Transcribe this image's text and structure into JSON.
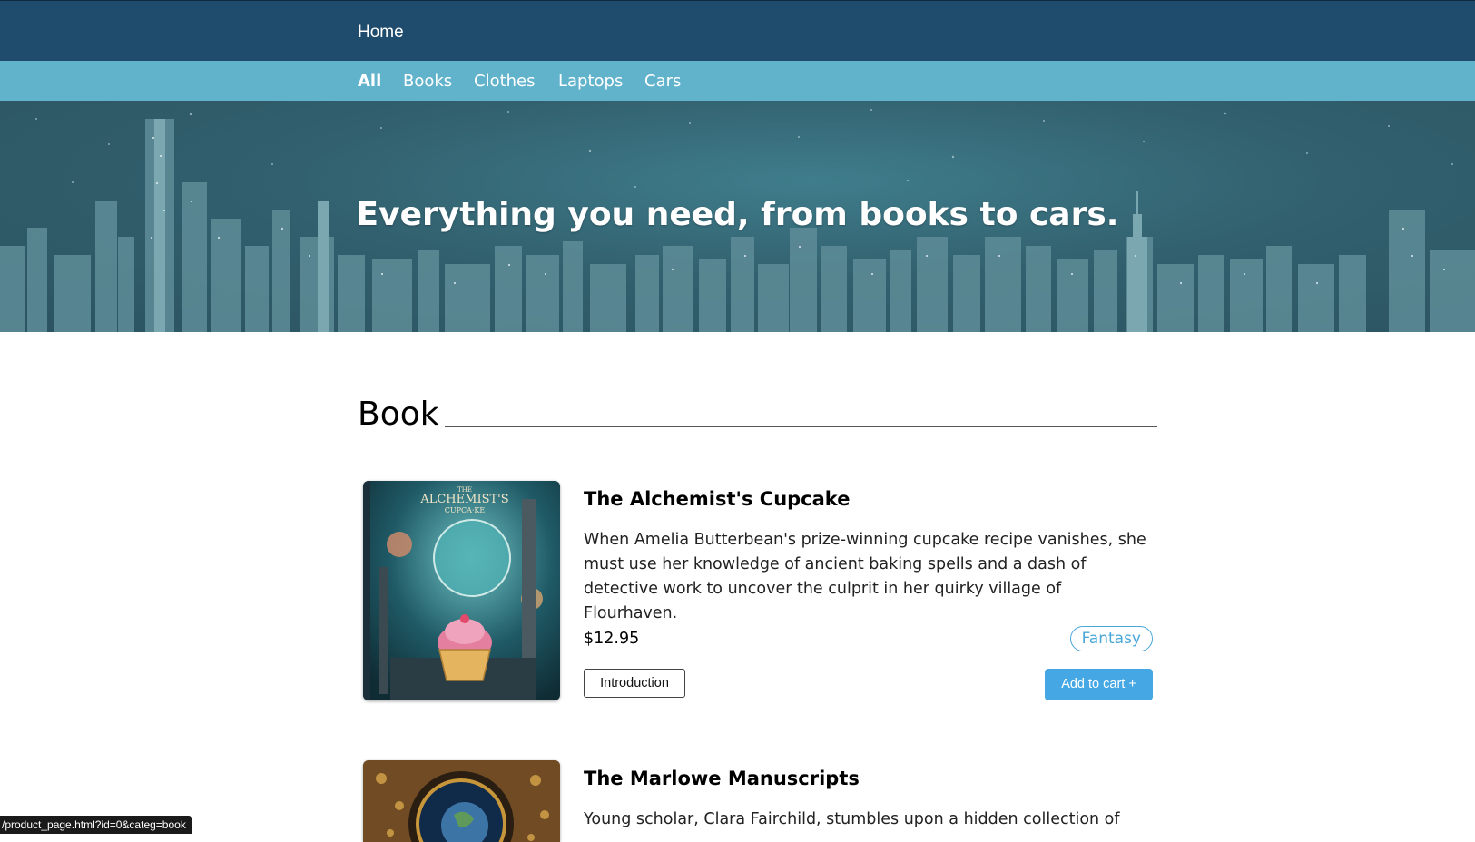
{
  "header": {
    "home_label": "Home"
  },
  "categories": [
    {
      "label": "All",
      "active": true
    },
    {
      "label": "Books",
      "active": false
    },
    {
      "label": "Clothes",
      "active": false
    },
    {
      "label": "Laptops",
      "active": false
    },
    {
      "label": "Cars",
      "active": false
    }
  ],
  "hero": {
    "title": "Everything you need, from books to cars."
  },
  "section": {
    "title": "Book"
  },
  "products": [
    {
      "title": "The Alchemist's Cupcake",
      "cover_title_line1": "THE",
      "cover_title_line2": "ALCHEMIST'S",
      "cover_title_line3": "CUPCA·KE",
      "description": "When Amelia Butterbean's prize-winning cupcake recipe vanishes, she must use her knowledge of ancient baking spells and a dash of detective work to uncover the culprit in her quirky village of Flourhaven.",
      "price": "$12.95",
      "tag": "Fantasy",
      "intro_label": "Introduction",
      "cart_label": "Add to cart +"
    },
    {
      "title": "The Marlowe Manuscripts",
      "description": "Young scholar, Clara Fairchild, stumbles upon a hidden collection of"
    }
  ],
  "status_url": "/product_page.html?id=0&categ=book",
  "colors": {
    "topbar": "#1f4b6c",
    "category_bar": "#61b3cc",
    "accent": "#45a7e3",
    "tag": "#4aa7d9"
  }
}
